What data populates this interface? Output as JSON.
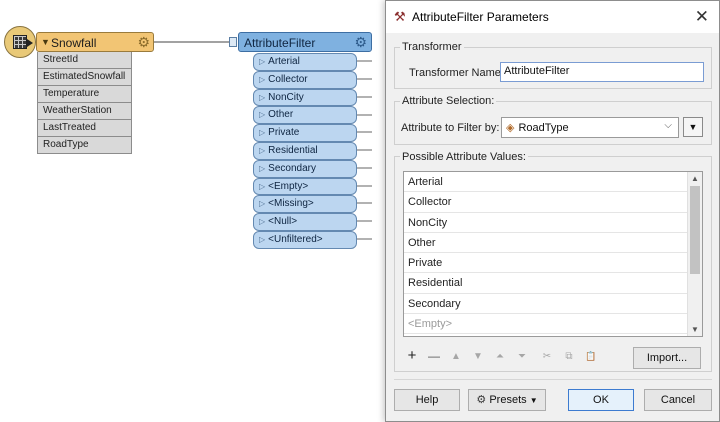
{
  "canvas": {
    "reader": {
      "title": "Snowfall",
      "attributes": [
        "StreetId",
        "EstimatedSnowfall",
        "Temperature",
        "WeatherStation",
        "LastTreated",
        "RoadType"
      ]
    },
    "transformer": {
      "title": "AttributeFilter",
      "ports": [
        "Arterial",
        "Collector",
        "NonCity",
        "Other",
        "Private",
        "Residential",
        "Secondary",
        "<Empty>",
        "<Missing>",
        "<Null>",
        "<Unfiltered>"
      ]
    }
  },
  "dialog": {
    "title": "AttributeFilter Parameters",
    "close_glyph": "✕",
    "transformer_group": "Transformer",
    "transformer_name_label": "Transformer Name:",
    "transformer_name_value": "AttributeFilter",
    "attribute_selection_group": "Attribute Selection:",
    "attribute_to_filter_label": "Attribute to Filter by:",
    "attribute_to_filter_value": "RoadType",
    "possible_values_group": "Possible Attribute Values:",
    "possible_values": [
      "Arterial",
      "Collector",
      "NonCity",
      "Other",
      "Private",
      "Residential",
      "Secondary",
      "<Empty>"
    ],
    "toolbar": {
      "add": "+",
      "remove": "—",
      "move_up": "▲",
      "move_down": "▼",
      "move_top": "⏶",
      "move_bottom": "⏷",
      "cut": "✂",
      "copy": "⧉",
      "paste": "📋"
    },
    "import_button": "Import...",
    "help_button": "Help",
    "presets_button": "Presets",
    "ok_button": "OK",
    "cancel_button": "Cancel"
  },
  "colors": {
    "reader": "#f2c574",
    "transformer": "#7fb1e0",
    "port": "#bcd6f0",
    "dialog_bg": "#f0f0f0"
  }
}
